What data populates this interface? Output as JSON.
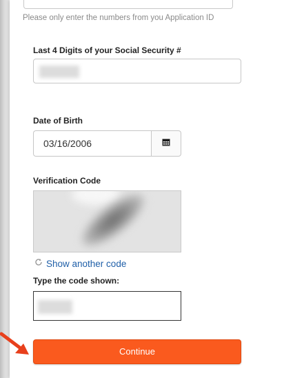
{
  "form": {
    "application_hint": "Please only enter the numbers from you Application ID",
    "ssn_label": "Last 4 Digits of your Social Security #",
    "dob_label": "Date of Birth",
    "dob_value": "03/16/2006",
    "verification_label": "Verification Code",
    "refresh_link": "Show another code",
    "code_label": "Type the code shown:",
    "continue_label": "Continue"
  },
  "icons": {
    "calendar": "calendar-icon",
    "refresh": "refresh-icon",
    "arrow": "arrow-annotation-icon"
  },
  "colors": {
    "accent": "#fa5a1e",
    "link": "#1f5fa8",
    "annotation_arrow": "#e8401c"
  }
}
